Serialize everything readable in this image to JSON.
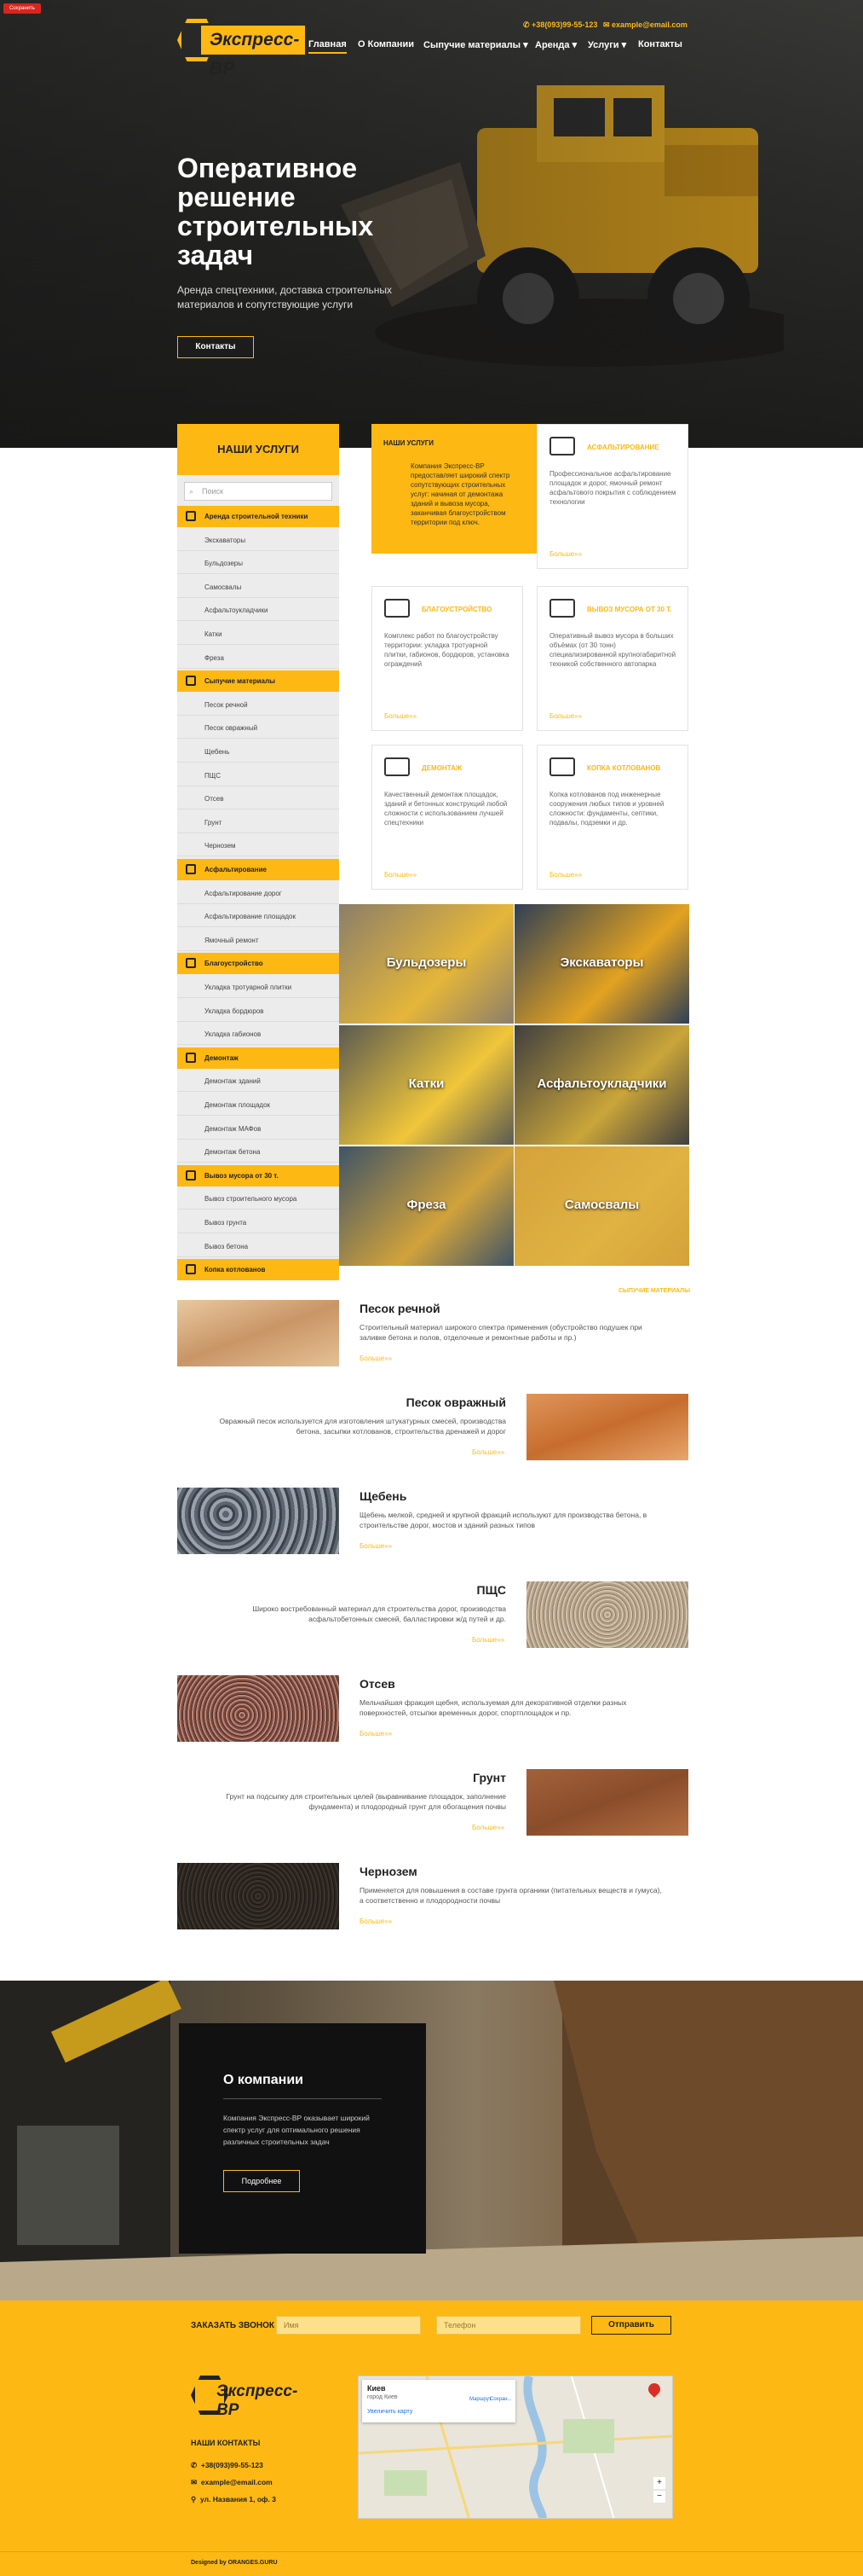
{
  "header": {
    "logo_text": "Экспресс-ВР",
    "phone": "+38(093)99-55-123",
    "email": "example@email.com",
    "nav": [
      "Главная",
      "О Компании",
      "Сыпучие материалы",
      "Аренда",
      "Услуги",
      "Контакты"
    ]
  },
  "save_badge": "Сохранить",
  "hero": {
    "title": "Оперативное решение строительных задач",
    "subtitle": "Аренда спецтехники, доставка строительных материалов и сопутствующие услуги",
    "button": "Контакты"
  },
  "sidebar": {
    "title": "НАШИ УСЛУГИ",
    "search_placeholder": "Поиск",
    "rows": [
      {
        "label": "Аренда строительной техники",
        "cat": true
      },
      {
        "label": "Экскаваторы"
      },
      {
        "label": "Бульдозеры"
      },
      {
        "label": "Самосвалы"
      },
      {
        "label": "Асфальтоукладчики"
      },
      {
        "label": "Катки"
      },
      {
        "label": "Фреза"
      },
      {
        "label": "Сыпучие материалы",
        "cat": true
      },
      {
        "label": "Песок речной"
      },
      {
        "label": "Песок овражный"
      },
      {
        "label": "Щебень"
      },
      {
        "label": "ПЩС"
      },
      {
        "label": "Отсев"
      },
      {
        "label": "Грунт"
      },
      {
        "label": "Чернозем"
      },
      {
        "label": "Асфальтирование",
        "cat": true
      },
      {
        "label": "Асфальтирование дорог"
      },
      {
        "label": "Асфальтирование площадок"
      },
      {
        "label": "Ямочный ремонт"
      },
      {
        "label": "Благоустройство",
        "cat": true
      },
      {
        "label": "Укладка тротуарной плитки"
      },
      {
        "label": "Укладка бордюров"
      },
      {
        "label": "Укладка габионов"
      },
      {
        "label": "Демонтаж",
        "cat": true
      },
      {
        "label": "Демонтаж зданий"
      },
      {
        "label": "Демонтаж площадок"
      },
      {
        "label": "Демонтаж МАФов"
      },
      {
        "label": "Демонтаж бетона"
      },
      {
        "label": "Вывоз мусора от 30 т.",
        "cat": true
      },
      {
        "label": "Вывоз строительного мусора"
      },
      {
        "label": "Вывоз грунта"
      },
      {
        "label": "Вывоз бетона"
      },
      {
        "label": "Копка котлованов",
        "cat": true
      }
    ]
  },
  "cards": [
    {
      "title": "НАШИ УСЛУГИ",
      "text": "Компания Экспресс-ВР предоставляет широкий спектр сопутствующих строительных услуг: начиная от демонтажа зданий и вывоза мусора, заканчивая благоустройством территории под ключ.",
      "more": ""
    },
    {
      "title": "АСФАЛЬТИРОВАНИЕ",
      "text": "Профессиональное асфальтирование площадок и дорог, ямочный ремонт асфальтового покрытия с соблюдением технологии",
      "more": "Больше»»"
    },
    {
      "title": "БЛАГОУСТРОЙСТВО",
      "text": "Комплекс работ по благоустройству территории: укладка тротуарной плитки, габионов, бордюров, установка ограждений",
      "more": "Больше»»"
    },
    {
      "title": "ВЫВОЗ МУСОРА ОТ 30 Т.",
      "text": "Оперативный вывоз мусора в больших объёмах (от 30 тонн) специализированной крупногабаритной техникой собственного автопарка",
      "more": "Больше»»"
    },
    {
      "title": "ДЕМОНТАЖ",
      "text": "Качественный демонтаж площадок, зданий и бетонных конструкций любой сложности с использованием лучшей спецтехники",
      "more": "Больше»»"
    },
    {
      "title": "КОПКА КОТЛОВАНОВ",
      "text": "Копка котлованов под инженерные сооружения любых типов и уровней сложности: фундаменты, септики, подвалы, подземки и др.",
      "more": "Больше»»"
    }
  ],
  "tiles": [
    "Бульдозеры",
    "Экскаваторы",
    "Катки",
    "Асфальтоукладчики",
    "Фреза",
    "Самосвалы"
  ],
  "materials_link": "СЫПУЧИЕ МАТЕРИАЛЫ",
  "materials": [
    {
      "title": "Песок речной",
      "text": "Строительный материал широкого спектра применения (обустройство подушек при заливке бетона и полов, отделочные и ремонтные работы и пр.)",
      "more": "Больше»»"
    },
    {
      "title": "Песок овражный",
      "text": "Овражный песок используется для изготовления штукатурных смесей, производства бетона, засыпки котлованов, строительства дренажей и дорог",
      "more": "Больше»»"
    },
    {
      "title": "Щебень",
      "text": "Щебень мелкой, средней и крупной фракций используют для производства бетона, в строительстве дорог, мостов и зданий разных типов",
      "more": "Больше»»"
    },
    {
      "title": "ПЩС",
      "text": "Широко востребованный материал для строительства дорог, производства асфальтобетонных смесей, балластировки ж/д путей и др.",
      "more": "Больше»»"
    },
    {
      "title": "Отсев",
      "text": "Мельчайшая фракция щебня, используемая для декоративной отделки разных поверхностей, отсыпки временных дорог, спортплощадок и пр.",
      "more": "Больше»»"
    },
    {
      "title": "Грунт",
      "text": "Грунт на подсыпку для строительных целей (выравнивание площадок, заполнение фундамента) и плодородный грунт для обогащения почвы",
      "more": "Больше»»"
    },
    {
      "title": "Чернозем",
      "text": "Применяется для повышения в составе грунта органики (питательных веществ и гумуса), а соответственно и плодородности почвы",
      "more": "Больше»»"
    }
  ],
  "about": {
    "title": "О компании",
    "text": "Компания Экспресс-ВР оказывает широкий спектр услуг для оптимального решения различных строительных задач",
    "button": "Подробнее"
  },
  "callback": {
    "label": "ЗАКАЗАТЬ ЗВОНОК",
    "name_placeholder": "Имя",
    "phone_placeholder": "Телефон",
    "button": "Отправить"
  },
  "footer": {
    "contacts_title": "НАШИ КОНТАКТЫ",
    "phone": "+38(093)99-55-123",
    "email": "example@email.com",
    "address": "ул. Названия 1, оф. 3",
    "map_city": "Киев",
    "map_sub": "город Киев",
    "map_route": "Маршрут",
    "map_save": "Сохран...",
    "map_larger": "Увеличить карту",
    "credit": "Designed by ORANGES.GURU"
  }
}
